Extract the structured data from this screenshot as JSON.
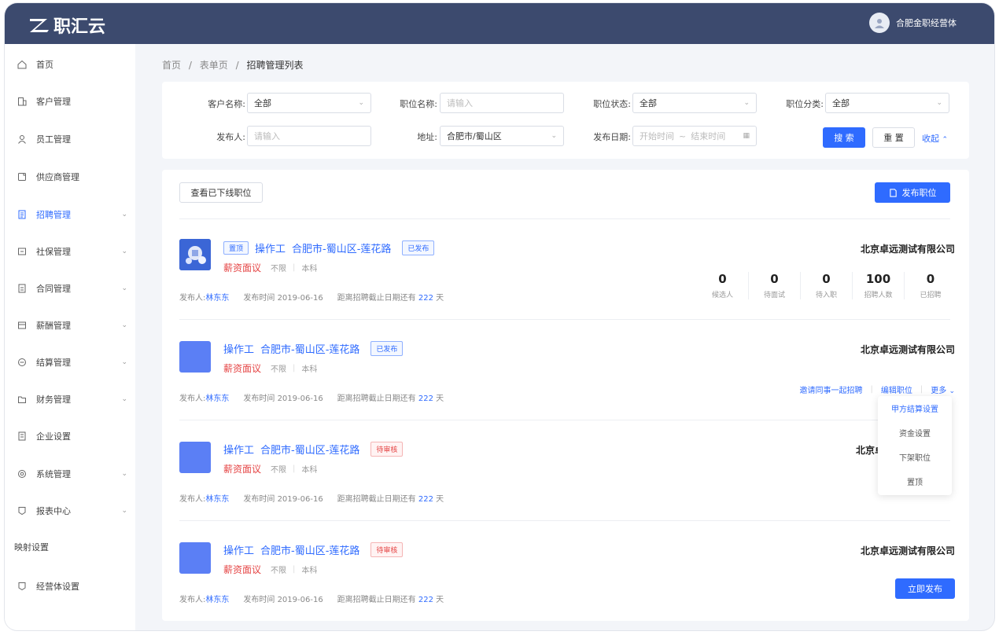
{
  "app": {
    "logo_text": "职汇云",
    "user_name": "合肥金职经营体"
  },
  "sidebar": {
    "items": [
      {
        "label": "首页",
        "icon": "home-icon",
        "chevron": false,
        "active": false
      },
      {
        "label": "客户管理",
        "icon": "building-icon",
        "chevron": false,
        "active": false
      },
      {
        "label": "员工管理",
        "icon": "user-icon",
        "chevron": false,
        "active": false
      },
      {
        "label": "供应商管理",
        "icon": "supplier-icon",
        "chevron": false,
        "active": false
      },
      {
        "label": "招聘管理",
        "icon": "recruit-icon",
        "chevron": true,
        "active": true
      },
      {
        "label": "社保管理",
        "icon": "insurance-icon",
        "chevron": true,
        "active": false
      },
      {
        "label": "合同管理",
        "icon": "contract-icon",
        "chevron": true,
        "active": false
      },
      {
        "label": "薪酬管理",
        "icon": "salary-icon",
        "chevron": true,
        "active": false
      },
      {
        "label": "结算管理",
        "icon": "settlement-icon",
        "chevron": true,
        "active": false
      },
      {
        "label": "财务管理",
        "icon": "finance-icon",
        "chevron": true,
        "active": false
      },
      {
        "label": "企业设置",
        "icon": "enterprise-icon",
        "chevron": false,
        "active": false
      },
      {
        "label": "系统管理",
        "icon": "system-icon",
        "chevron": true,
        "active": false
      },
      {
        "label": "报表中心",
        "icon": "report-icon",
        "chevron": true,
        "active": false
      }
    ],
    "section_label": "映射设置",
    "bottom_item": {
      "label": "经营体设置",
      "icon": "shield-icon"
    }
  },
  "breadcrumb": {
    "home": "首页",
    "sep1": "/",
    "mid": "表单页",
    "sep2": "/",
    "current": "招聘管理列表"
  },
  "filters": {
    "customer": {
      "label": "客户名称:",
      "value": "全部"
    },
    "job_name": {
      "label": "职位名称:",
      "placeholder": "请输入"
    },
    "job_status": {
      "label": "职位状态:",
      "value": "全部"
    },
    "job_category": {
      "label": "职位分类:",
      "value": "全部"
    },
    "publisher": {
      "label": "发布人:",
      "placeholder": "请输入"
    },
    "location": {
      "label": "地址:",
      "value": "合肥市/蜀山区"
    },
    "publish_date": {
      "label": "发布日期:",
      "start": "开始时间",
      "dash": "~",
      "end": "结束时间"
    },
    "search_label": "搜 索",
    "reset_label": "重 置",
    "collapse_label": "收起"
  },
  "toolbar": {
    "offline_label": "查看已下线职位",
    "publish_label": "发布职位"
  },
  "jobs": [
    {
      "tag": "置顶",
      "title": "操作工",
      "location": "合肥市-蜀山区-莲花路",
      "status": "已发布",
      "salary": "薪资面议",
      "limit": "不限",
      "education": "本科",
      "publisher_label": "发布人:",
      "publisher": "林东东",
      "time_label": "发布时间",
      "time": "2019-06-16",
      "deadline_label": "距离招聘截止日期还有",
      "deadline_days": "222",
      "deadline_unit": "天",
      "company": "北京卓远测试有限公司",
      "stats": [
        {
          "num": "0",
          "label": "候选人"
        },
        {
          "num": "0",
          "label": "待面试"
        },
        {
          "num": "0",
          "label": "待入职"
        },
        {
          "num": "100",
          "label": "招聘人数"
        },
        {
          "num": "0",
          "label": "已招聘"
        }
      ]
    },
    {
      "title": "操作工",
      "location": "合肥市-蜀山区-莲花路",
      "status": "已发布",
      "salary": "薪资面议",
      "limit": "不限",
      "education": "本科",
      "publisher_label": "发布人:",
      "publisher": "林东东",
      "time_label": "发布时间",
      "time": "2019-06-16",
      "deadline_label": "距离招聘截止日期还有",
      "deadline_days": "222",
      "deadline_unit": "天",
      "company": "北京卓远测试有限公司",
      "actions": {
        "invite": "邀请同事一起招聘",
        "edit": "编辑职位",
        "more": "更多"
      }
    },
    {
      "title": "操作工",
      "location": "合肥市-蜀山区-莲花路",
      "status": "待审核",
      "salary": "薪资面议",
      "limit": "不限",
      "education": "本科",
      "publisher_label": "发布人:",
      "publisher": "林东东",
      "time_label": "发布时间",
      "time": "2019-06-16",
      "deadline_label": "距离招聘截止日期还有",
      "deadline_days": "222",
      "deadline_unit": "天",
      "company": "北京卓远"
    },
    {
      "title": "操作工",
      "location": "合肥市-蜀山区-莲花路",
      "status": "待审核",
      "salary": "薪资面议",
      "limit": "不限",
      "education": "本科",
      "publisher_label": "发布人:",
      "publisher": "林东东",
      "time_label": "发布时间",
      "time": "2019-06-16",
      "deadline_label": "距离招聘截止日期还有",
      "deadline_days": "222",
      "deadline_unit": "天",
      "company": "北京卓远测试有限公司",
      "publish_now": "立即发布"
    }
  ],
  "more_menu": [
    "甲方结算设置",
    "资金设置",
    "下架职位",
    "置顶"
  ],
  "colors": {
    "primary": "#2f6bff",
    "header": "#3c4a6e",
    "danger": "#e54545"
  }
}
